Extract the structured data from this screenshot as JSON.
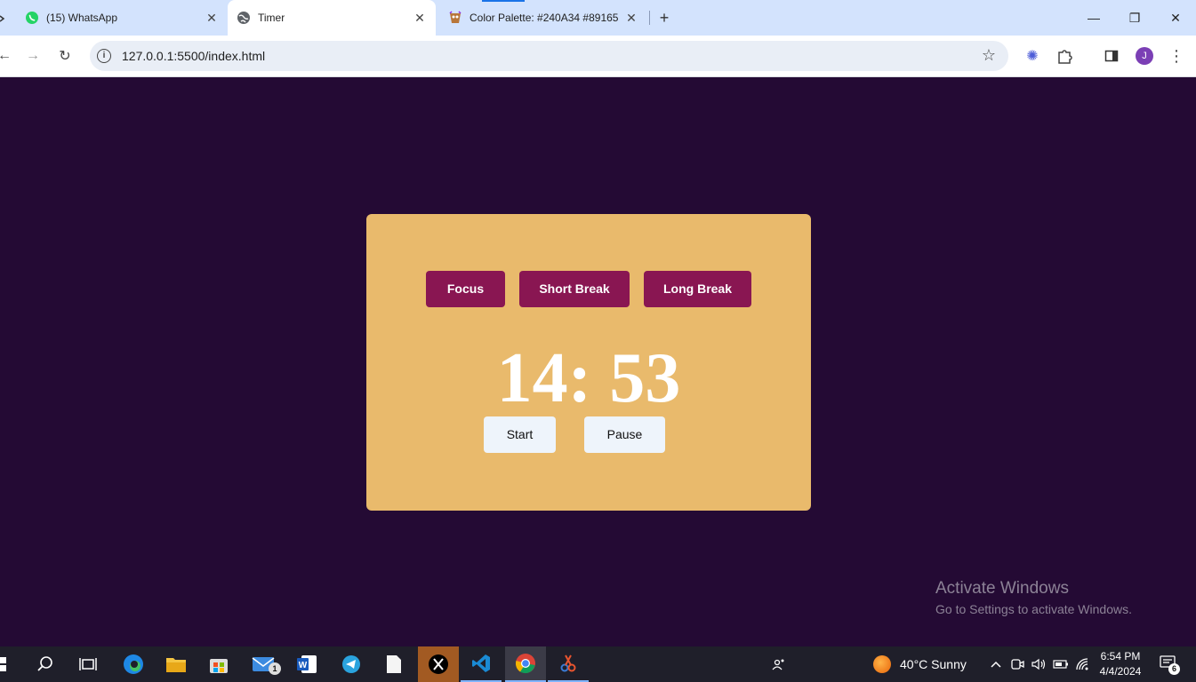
{
  "browser": {
    "tabs": [
      {
        "title": "(15) WhatsApp",
        "icon": "whatsapp-icon"
      },
      {
        "title": "Timer",
        "icon": "globe-icon",
        "active": true
      },
      {
        "title": "Color Palette: #240A34 #89165",
        "icon": "palette-icon"
      }
    ],
    "address": "127.0.0.1:5500/index.html",
    "profile_initial": "J"
  },
  "colors": {
    "page_bg": "#240A34",
    "card_bg": "#E9BA6C",
    "mode_button": "#891652",
    "control_button": "#EEF4FB"
  },
  "timer": {
    "modes": [
      "Focus",
      "Short Break",
      "Long Break"
    ],
    "time": "14: 53",
    "start_label": "Start",
    "pause_label": "Pause"
  },
  "watermark": {
    "line1": "Activate Windows",
    "line2": "Go to Settings to activate Windows."
  },
  "taskbar": {
    "mail_badge": "1",
    "weather": "40°C  Sunny",
    "time": "6:54 PM",
    "date": "4/4/2024",
    "notifications": "6"
  }
}
